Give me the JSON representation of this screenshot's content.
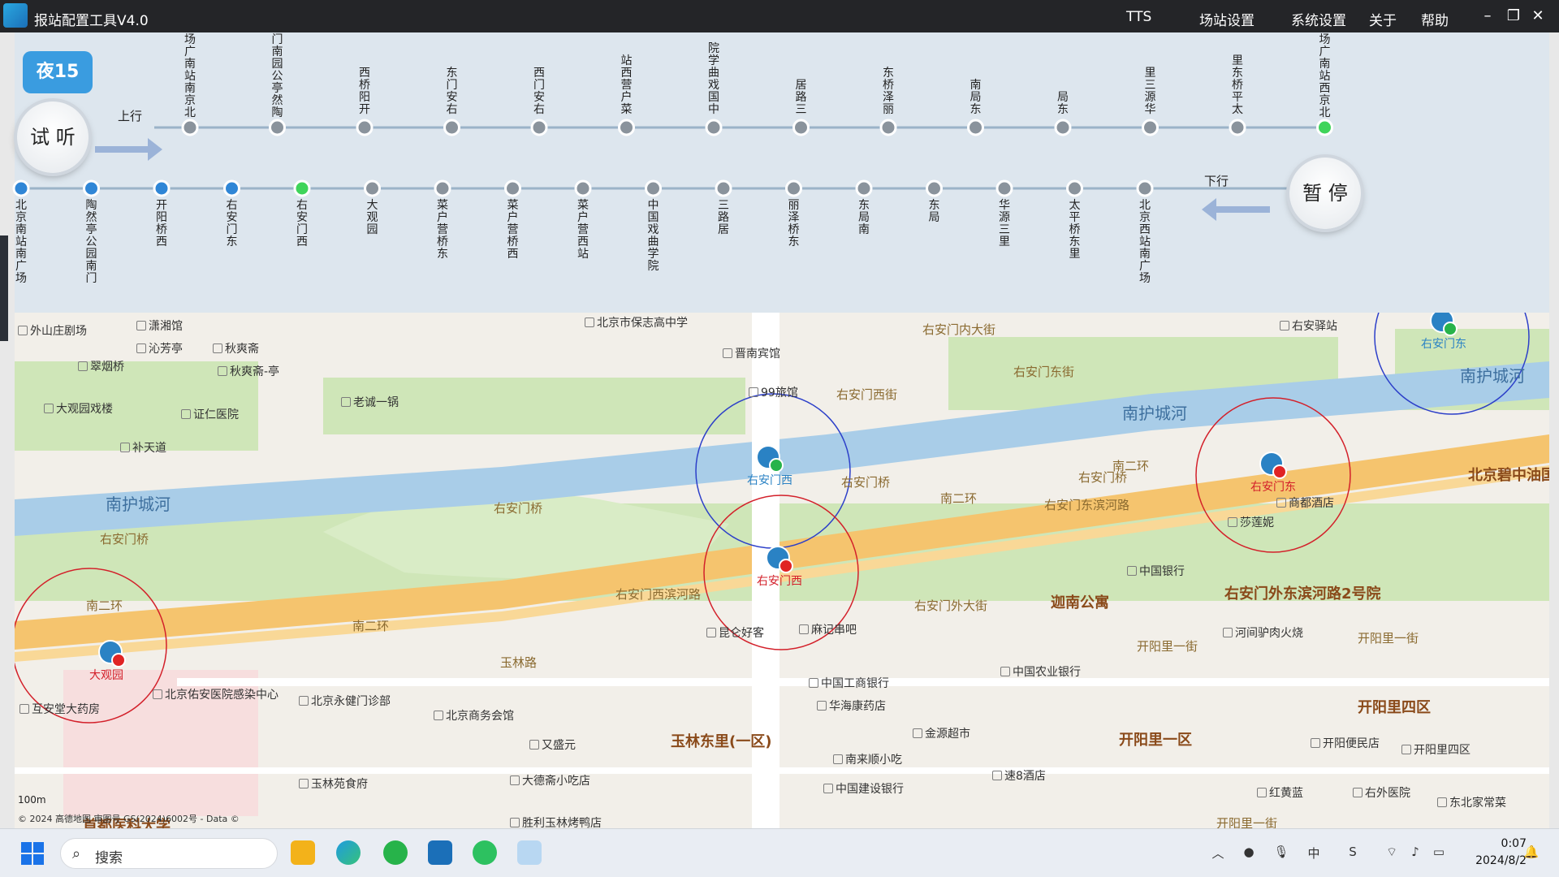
{
  "titlebar": {
    "title": "报站配置工具V4.0",
    "menu": [
      "TTS",
      "场站设置",
      "系统设置",
      "关于",
      "帮助"
    ]
  },
  "route": {
    "badge": "夜15",
    "play_label": "试 听",
    "pause_label": "暂 停",
    "up_label": "上行",
    "down_label": "下行",
    "up_stops": [
      "场广南站南京北",
      "门南园公亭然陶",
      "西桥阳开",
      "东门安右",
      "西门安右",
      "站西营户菜",
      "院学曲戏国中",
      "居路三",
      "东桥泽丽",
      "南局东",
      "局东",
      "里三源华",
      "里东桥平太",
      "场广南站西京北"
    ],
    "up_active_index": 13,
    "down_stops": [
      "北京南站南广场",
      "陶然亭公园南门",
      "开阳桥西",
      "右安门东",
      "右安门西",
      "大观园",
      "菜户营桥东",
      "菜户营桥西",
      "菜户营西站",
      "中国戏曲学院",
      "三路居",
      "丽泽桥东",
      "东局南",
      "东局",
      "华源三里",
      "太平桥东里",
      "北京西站南广场"
    ],
    "down_active_index": 4,
    "down_blue_indices": [
      0,
      1,
      2,
      3
    ]
  },
  "map": {
    "labels": [
      {
        "text": "外山庄剧场",
        "kind": "poi"
      },
      {
        "text": "潇湘馆",
        "kind": "poi"
      },
      {
        "text": "沁芳亭",
        "kind": "poi"
      },
      {
        "text": "翠烟桥",
        "kind": "poi"
      },
      {
        "text": "秋爽斋",
        "kind": "poi"
      },
      {
        "text": "秋爽斋-亭",
        "kind": "poi"
      },
      {
        "text": "大观园戏楼",
        "kind": "poi"
      },
      {
        "text": "证仁医院",
        "kind": "poi"
      },
      {
        "text": "补天道",
        "kind": "poi"
      },
      {
        "text": "老诚一锅",
        "kind": "poi"
      },
      {
        "text": "晋南宾馆",
        "kind": "poi"
      },
      {
        "text": "99旅馆",
        "kind": "poi"
      },
      {
        "text": "北京市保志高中学",
        "kind": "poi"
      },
      {
        "text": "右安驿站",
        "kind": "poi"
      },
      {
        "text": "南护城河",
        "kind": "water"
      },
      {
        "text": "南护城河",
        "kind": "water"
      },
      {
        "text": "南护城河",
        "kind": "water"
      },
      {
        "text": "右安门东街",
        "kind": "road"
      },
      {
        "text": "右安门西街",
        "kind": "road"
      },
      {
        "text": "右安门桥",
        "kind": "road"
      },
      {
        "text": "右安门桥",
        "kind": "road"
      },
      {
        "text": "右安门桥",
        "kind": "road"
      },
      {
        "text": "右安门外大街",
        "kind": "road"
      },
      {
        "text": "右安门内大街",
        "kind": "road"
      },
      {
        "text": "右安门东滨河路",
        "kind": "road"
      },
      {
        "text": "右安门西滨河路",
        "kind": "road"
      },
      {
        "text": "南二环",
        "kind": "road"
      },
      {
        "text": "南二环",
        "kind": "road"
      },
      {
        "text": "南二环",
        "kind": "road"
      },
      {
        "text": "南二环",
        "kind": "road"
      },
      {
        "text": "右安门桥",
        "kind": "road"
      },
      {
        "text": "莎莲妮",
        "kind": "poi"
      },
      {
        "text": "商都酒店",
        "kind": "poi"
      },
      {
        "text": "北京碧中油国际商务会",
        "kind": "area"
      },
      {
        "text": "中国银行",
        "kind": "poi"
      },
      {
        "text": "迦南公寓",
        "kind": "area"
      },
      {
        "text": "右安门外东滨河路2号院",
        "kind": "area"
      },
      {
        "text": "河间驴肉火烧",
        "kind": "poi"
      },
      {
        "text": "开阳里一街",
        "kind": "road"
      },
      {
        "text": "开阳里一街",
        "kind": "road"
      },
      {
        "text": "昆仑好客",
        "kind": "poi"
      },
      {
        "text": "麻记串吧",
        "kind": "poi"
      },
      {
        "text": "中国工商银行",
        "kind": "poi"
      },
      {
        "text": "华海康药店",
        "kind": "poi"
      },
      {
        "text": "中国农业银行",
        "kind": "poi"
      },
      {
        "text": "金源超市",
        "kind": "poi"
      },
      {
        "text": "南来顺小吃",
        "kind": "poi"
      },
      {
        "text": "中国建设银行",
        "kind": "poi"
      },
      {
        "text": "速8酒店",
        "kind": "poi"
      },
      {
        "text": "开阳里一区",
        "kind": "area"
      },
      {
        "text": "开阳里四区",
        "kind": "area"
      },
      {
        "text": "开阳便民店",
        "kind": "poi"
      },
      {
        "text": "开阳里四区",
        "kind": "poi"
      },
      {
        "text": "红黄蓝",
        "kind": "poi"
      },
      {
        "text": "右外医院",
        "kind": "poi"
      },
      {
        "text": "东北家常菜",
        "kind": "poi"
      },
      {
        "text": "玉林东里(一区)",
        "kind": "area"
      },
      {
        "text": "又盛元",
        "kind": "poi"
      },
      {
        "text": "大德斋小吃店",
        "kind": "poi"
      },
      {
        "text": "北京商务会馆",
        "kind": "poi"
      },
      {
        "text": "北京永健门诊部",
        "kind": "poi"
      },
      {
        "text": "互安堂大药房",
        "kind": "poi"
      },
      {
        "text": "北京佑安医院感染中心",
        "kind": "poi"
      },
      {
        "text": "玉林苑食府",
        "kind": "poi"
      },
      {
        "text": "胜利玉林烤鸭店",
        "kind": "poi"
      },
      {
        "text": "首都医科大学",
        "kind": "area"
      },
      {
        "text": "玉林路",
        "kind": "road"
      },
      {
        "text": "开阳里一街",
        "kind": "road"
      }
    ],
    "stations": [
      {
        "name": "大观园",
        "color": "#d3202a",
        "kind": "red"
      },
      {
        "name": "右安门西",
        "color": "#2a82c4",
        "kind": "green"
      },
      {
        "name": "右安门西",
        "color": "#d3202a",
        "kind": "red"
      },
      {
        "name": "右安门东",
        "color": "#d3202a",
        "kind": "red"
      },
      {
        "name": "右安门东",
        "color": "#2a82c4",
        "kind": "green"
      }
    ],
    "scale": "100m",
    "copyright": "© 2024 高德地图 审图号 GS(2024)6002号 - Data ©"
  },
  "taskbar": {
    "search_placeholder": "搜索",
    "time": "0:07",
    "date": "2024/8/2",
    "ime_label": "中"
  }
}
